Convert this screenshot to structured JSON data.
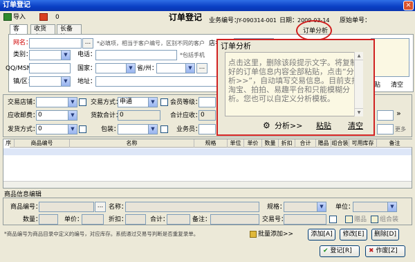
{
  "window": {
    "title": "订单登记",
    "close_glyph": "×"
  },
  "toolbar": {
    "import_label": "导入",
    "export_count": "0"
  },
  "header": {
    "form_title": "订单登记",
    "business_no_label": "业务编号：",
    "business_no_value": "JY-090314-001",
    "date_label": "日期：",
    "date_value": "2009-03-14",
    "orig_no_label": "原始单号："
  },
  "tabs": [
    {
      "label": "客户"
    },
    {
      "label": "收货人"
    },
    {
      "label": "长备注"
    }
  ],
  "customer": {
    "name_label": "网名：",
    "name_hint": "*必填项，相当于客户编号，区别不同的客户",
    "shop_label": "店名：",
    "category_label": "类别：",
    "phone_label": "电话：",
    "phone_hint": "*包括手机",
    "qq_label": "QQ/MSN：",
    "country_label": "国家：",
    "province_label": "省/州：",
    "district_label": "镇/区：",
    "address_label": "地址："
  },
  "order_analysis_button": "订单分析",
  "side_texts": {
    "paste": "贴",
    "clear": "清空",
    "more_arrow": "»",
    "more": "更多"
  },
  "trade": {
    "store_label": "交易店铺：",
    "method_label": "交易方式：",
    "method_value": "申通",
    "member_label": "会员等级：",
    "receivable_label": "应收邮费：",
    "receivable_value": "0",
    "goods_total_label": "货款合计：",
    "goods_total_value": "0",
    "total_label": "合计应收：",
    "total_value": "0",
    "ship_label": "发货方式：",
    "ship_value": "0",
    "pack_label": "包装：",
    "staff_label": "业务员："
  },
  "grid": {
    "columns": [
      "序",
      "商品编号",
      "名称",
      "规格",
      "单位",
      "单价",
      "数量",
      "折扣",
      "合计",
      "赠品",
      "组合装",
      "可用库存",
      "备注"
    ]
  },
  "item_edit": {
    "section_title": "商品信息编辑",
    "code_label": "商品编号：",
    "name_label": "名称：",
    "spec_label": "规格：",
    "unit_label": "单位：",
    "qty_label": "数量：",
    "price_label": "单价：",
    "discount_label": "折扣：",
    "total_label": "合计：",
    "remark_label": "备注：",
    "trade_no_label": "交易号：",
    "gift_label": "赠品",
    "combo_label": "组合装"
  },
  "footer": {
    "hint": "*商品编号为商品目录中定义的编号，对应库存。系统通过交易号判断是否重复录单。",
    "batch_label": "批量添加>>",
    "add_label": "添加[A]",
    "modify_label": "修改[E]",
    "delete_label": "删除[D]",
    "register_label": "登记[R]",
    "void_label": "作废[Z]"
  },
  "popup": {
    "title": "订单分析",
    "body": "点击这里，删除该段提示文字。将复制好的订单信息内容全部粘贴，点击“分析>>”，自动填写交易信息。目前支持淘宝、拍拍、易趣平台和只能模糊分析。您也可以自定义分析模板。",
    "analyze_label": "分析>>",
    "paste_label": "粘贴",
    "clear_label": "清空"
  },
  "colors": {
    "titlebar": "#0a3fc4",
    "highlight": "#d02020",
    "required": "#d00000"
  }
}
